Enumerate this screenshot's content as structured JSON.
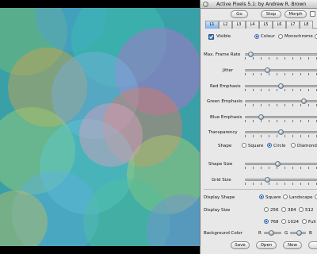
{
  "window": {
    "title": "Active Pixels 5.1: by Andrew R. Brown"
  },
  "toolbar": {
    "go_label": "Go",
    "stop_label": "Stop",
    "morph_label": "Morph"
  },
  "tabs": [
    "L1",
    "L2",
    "L3",
    "L4",
    "L5",
    "L6",
    "L7",
    "L8"
  ],
  "layer": {
    "visible_label": "Visible",
    "visible_checked": true,
    "colour_label": "Colour",
    "monochrome_label": "Monochrome",
    "mode_selected": "Colour"
  },
  "sliders": {
    "max_frame_rate": {
      "label": "Max. Frame Rate",
      "value": 0.05
    },
    "jitter": {
      "label": "Jitter",
      "value": 0.3
    },
    "red_emphasis": {
      "label": "Red Emphasis",
      "value": 0.5
    },
    "green_emphasis": {
      "label": "Green Emphasis",
      "value": 0.85
    },
    "blue_emphasis": {
      "label": "Blue Emphasis",
      "value": 0.2
    },
    "transparency": {
      "label": "Transparency",
      "value": 0.5
    },
    "shape_size": {
      "label": "Shape Size",
      "value": 0.45
    },
    "grid_size": {
      "label": "Grid Size",
      "value": 0.3
    }
  },
  "shape": {
    "label": "Shape",
    "options": [
      "Square",
      "Circle",
      "Diamond"
    ],
    "selected": "Circle"
  },
  "display_shape": {
    "label": "Display Shape",
    "options": [
      "Square",
      "Landscape"
    ],
    "selected": "Square"
  },
  "display_size": {
    "label": "Display Size",
    "options": [
      "256",
      "384",
      "512",
      "768",
      "1024",
      "Full"
    ],
    "selected": "768"
  },
  "background_color": {
    "label": "Background Color",
    "r_label": "R",
    "g_label": "G",
    "b_label": "B"
  },
  "footer": {
    "save_label": "Save",
    "open_label": "Open",
    "new_label": "New"
  },
  "colors": {
    "panel_bg": "#e8e8e8",
    "selected_tab": "#7fb1ec",
    "canvas_bg": "#000000"
  }
}
